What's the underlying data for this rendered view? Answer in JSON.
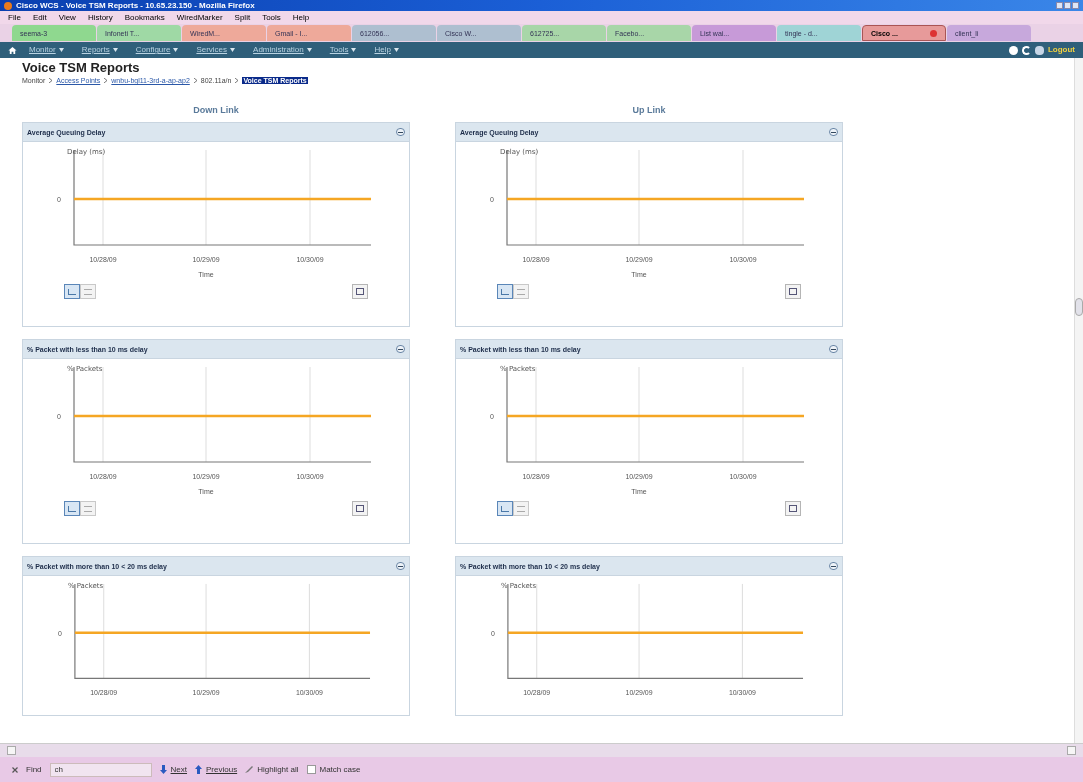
{
  "window": {
    "title": "Cisco WCS - Voice TSM Reports - 10.65.23.150 - Mozilla Firefox"
  },
  "menu_bar": [
    "File",
    "Edit",
    "View",
    "History",
    "Bookmarks",
    "WiredMarker",
    "Split",
    "Tools",
    "Help"
  ],
  "tabs": [
    {
      "label": "seema-3",
      "color": "#8fd88f",
      "selected": false
    },
    {
      "label": "Infoneti T...",
      "color": "#9fd9a5",
      "selected": false
    },
    {
      "label": "WiredM...",
      "color": "#eea99a",
      "selected": false
    },
    {
      "label": "Gmail - I...",
      "color": "#eea99a",
      "selected": false
    },
    {
      "label": "612056...",
      "color": "#aebfd0",
      "selected": false
    },
    {
      "label": "Cisco W...",
      "color": "#aebfd0",
      "selected": false
    },
    {
      "label": "612725...",
      "color": "#a8d6a8",
      "selected": false
    },
    {
      "label": "Facebo...",
      "color": "#a8d6a8",
      "selected": false
    },
    {
      "label": "List wai...",
      "color": "#c79ad8",
      "selected": false
    },
    {
      "label": "tingle - d...",
      "color": "#9fd4d6",
      "selected": false
    },
    {
      "label": "Cisco ...",
      "color": "#e79a9a",
      "selected": true
    },
    {
      "label": "client_li",
      "color": "#c7a8dc",
      "selected": false
    }
  ],
  "nav": {
    "items": [
      "Monitor",
      "Reports",
      "Configure",
      "Services",
      "Administration",
      "Tools",
      "Help"
    ],
    "logout": "Logout"
  },
  "page": {
    "title": "Voice TSM Reports",
    "breadcrumb": [
      {
        "label": "Monitor",
        "kind": "text"
      },
      {
        "label": "Access Points",
        "kind": "link"
      },
      {
        "label": "wnbu-bgl11-3rd-a-ap-ap2",
        "kind": "link"
      },
      {
        "label": "802.11a/n",
        "kind": "text"
      },
      {
        "label": "Voice TSM Reports",
        "kind": "current"
      }
    ]
  },
  "columns": [
    {
      "heading": "Down Link",
      "panels": [
        {
          "title": "Average Queuing Delay",
          "y_axis_title": "Delay (ms)",
          "y_tick": "0",
          "x_ticks": [
            "10/28/09",
            "10/29/09",
            "10/30/09"
          ],
          "x_axis_title": "Time",
          "view_buttons": [
            {
              "kind": "chart",
              "selected": true
            },
            {
              "kind": "table",
              "selected": false
            }
          ]
        },
        {
          "title": "% Packet with less than 10 ms delay",
          "y_axis_title": "% Packets",
          "y_tick": "0",
          "x_ticks": [
            "10/28/09",
            "10/29/09",
            "10/30/09"
          ],
          "x_axis_title": "Time",
          "view_buttons": [
            {
              "kind": "chart",
              "selected": true
            },
            {
              "kind": "table",
              "selected": false
            }
          ]
        },
        {
          "title": "% Packet with more than 10 < 20 ms delay",
          "y_axis_title": "% Packets",
          "y_tick": "0",
          "x_ticks": [
            "10/28/09",
            "10/29/09",
            "10/30/09"
          ]
        }
      ]
    },
    {
      "heading": "Up Link",
      "panels": [
        {
          "title": "Average Queuing Delay",
          "y_axis_title": "Delay (ms)",
          "y_tick": "0",
          "x_ticks": [
            "10/28/09",
            "10/29/09",
            "10/30/09"
          ],
          "x_axis_title": "Time",
          "view_buttons": [
            {
              "kind": "chart",
              "selected": true
            },
            {
              "kind": "table",
              "selected": false
            }
          ]
        },
        {
          "title": "% Packet with less than 10 ms delay",
          "y_axis_title": "% Packets",
          "y_tick": "0",
          "x_ticks": [
            "10/28/09",
            "10/29/09",
            "10/30/09"
          ],
          "x_axis_title": "Time",
          "view_buttons": [
            {
              "kind": "chart",
              "selected": true
            },
            {
              "kind": "table",
              "selected": false
            }
          ]
        },
        {
          "title": "% Packet with more than 10 < 20 ms delay",
          "y_axis_title": "% Packets",
          "y_tick": "0",
          "x_ticks": [
            "10/28/09",
            "10/29/09",
            "10/30/09"
          ]
        }
      ]
    }
  ],
  "find_bar": {
    "label": "Find",
    "value": "ch",
    "next": "Next",
    "previous": "Previous",
    "highlight_all": "Highlight all",
    "match_case": {
      "label": "Match case",
      "checked": false
    }
  }
}
